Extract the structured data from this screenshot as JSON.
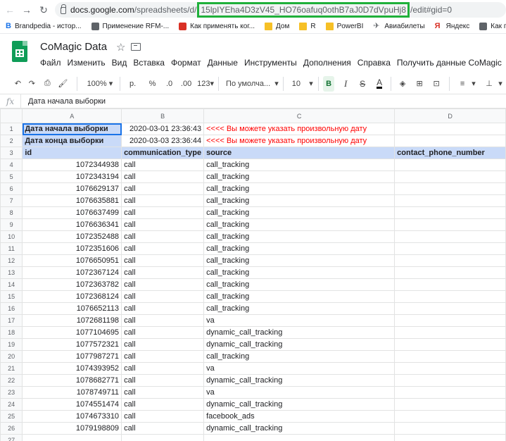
{
  "browser": {
    "url_host": "docs.google.com",
    "url_path": "/spreadsheets/d/",
    "url_highlight": "15lpIYEha4D3zV45_HO76oafuq0othB7aJ0D7dVpuHj8",
    "url_tail": "/edit#gid=0",
    "bookmarks": [
      {
        "label": "Brandpedia - истор...",
        "icon": "b-icon"
      },
      {
        "label": "Применение RFM-...",
        "icon": "page-icon"
      },
      {
        "label": "Как применять ког...",
        "icon": "ips-icon"
      },
      {
        "label": "Дом",
        "icon": "folder-icon"
      },
      {
        "label": "R",
        "icon": "folder-icon"
      },
      {
        "label": "PowerBI",
        "icon": "folder-icon"
      },
      {
        "label": "Авиабилеты",
        "icon": "plane-icon"
      },
      {
        "label": "Яндекс",
        "icon": "yandex-icon"
      },
      {
        "label": "Как посчитать вс",
        "icon": "page-icon"
      }
    ]
  },
  "doc": {
    "title": "CoMagic Data",
    "menu": [
      "Файл",
      "Изменить",
      "Вид",
      "Вставка",
      "Формат",
      "Данные",
      "Инструменты",
      "Дополнения",
      "Справка",
      "Получить данные CoMagic"
    ]
  },
  "toolbar": {
    "zoom": "100%",
    "currency": "р.",
    "percent": "%",
    "dec_decrease": ".0",
    "dec_increase": ".00",
    "more_formats": "123",
    "font": "По умолча...",
    "font_size": "10",
    "bold": "B",
    "italic": "I",
    "strike": "S",
    "text_color": "A"
  },
  "formula_bar": {
    "fx": "fx",
    "value": "Дата начала выборки"
  },
  "columns": [
    "A",
    "B",
    "C",
    "D"
  ],
  "rows": [
    {
      "n": "1",
      "a": "Дата начала выборки",
      "b": "2020-03-01 23:36:43",
      "c": "<<<< Вы можете указать произвольную дату",
      "d": ""
    },
    {
      "n": "2",
      "a": "Дата конца выборки",
      "b": "2020-03-03 23:36:44",
      "c": "<<<< Вы можете указать произвольную дату",
      "d": ""
    },
    {
      "n": "3",
      "a": "id",
      "b": "communication_type",
      "c": "source",
      "d": "contact_phone_number"
    },
    {
      "n": "4",
      "a": "1072344938",
      "b": "call",
      "c": "call_tracking",
      "d": ""
    },
    {
      "n": "5",
      "a": "1072343194",
      "b": "call",
      "c": "call_tracking",
      "d": ""
    },
    {
      "n": "6",
      "a": "1076629137",
      "b": "call",
      "c": "call_tracking",
      "d": ""
    },
    {
      "n": "7",
      "a": "1076635881",
      "b": "call",
      "c": "call_tracking",
      "d": ""
    },
    {
      "n": "8",
      "a": "1076637499",
      "b": "call",
      "c": "call_tracking",
      "d": ""
    },
    {
      "n": "9",
      "a": "1076636341",
      "b": "call",
      "c": "call_tracking",
      "d": ""
    },
    {
      "n": "10",
      "a": "1072352488",
      "b": "call",
      "c": "call_tracking",
      "d": ""
    },
    {
      "n": "11",
      "a": "1072351606",
      "b": "call",
      "c": "call_tracking",
      "d": ""
    },
    {
      "n": "12",
      "a": "1076650951",
      "b": "call",
      "c": "call_tracking",
      "d": ""
    },
    {
      "n": "13",
      "a": "1072367124",
      "b": "call",
      "c": "call_tracking",
      "d": ""
    },
    {
      "n": "14",
      "a": "1072363782",
      "b": "call",
      "c": "call_tracking",
      "d": ""
    },
    {
      "n": "15",
      "a": "1072368124",
      "b": "call",
      "c": "call_tracking",
      "d": ""
    },
    {
      "n": "16",
      "a": "1076652113",
      "b": "call",
      "c": "call_tracking",
      "d": ""
    },
    {
      "n": "17",
      "a": "1072681198",
      "b": "call",
      "c": "va",
      "d": ""
    },
    {
      "n": "18",
      "a": "1077104695",
      "b": "call",
      "c": "dynamic_call_tracking",
      "d": ""
    },
    {
      "n": "19",
      "a": "1077572321",
      "b": "call",
      "c": "dynamic_call_tracking",
      "d": ""
    },
    {
      "n": "20",
      "a": "1077987271",
      "b": "call",
      "c": "call_tracking",
      "d": ""
    },
    {
      "n": "21",
      "a": "1074393952",
      "b": "call",
      "c": "va",
      "d": ""
    },
    {
      "n": "22",
      "a": "1078682771",
      "b": "call",
      "c": "dynamic_call_tracking",
      "d": ""
    },
    {
      "n": "23",
      "a": "1078749711",
      "b": "call",
      "c": "va",
      "d": ""
    },
    {
      "n": "24",
      "a": "1074551474",
      "b": "call",
      "c": "dynamic_call_tracking",
      "d": ""
    },
    {
      "n": "25",
      "a": "1074673310",
      "b": "call",
      "c": "facebook_ads",
      "d": ""
    },
    {
      "n": "26",
      "a": "1079198809",
      "b": "call",
      "c": "dynamic_call_tracking",
      "d": ""
    },
    {
      "n": "27",
      "a": "",
      "b": "",
      "c": "",
      "d": ""
    }
  ]
}
